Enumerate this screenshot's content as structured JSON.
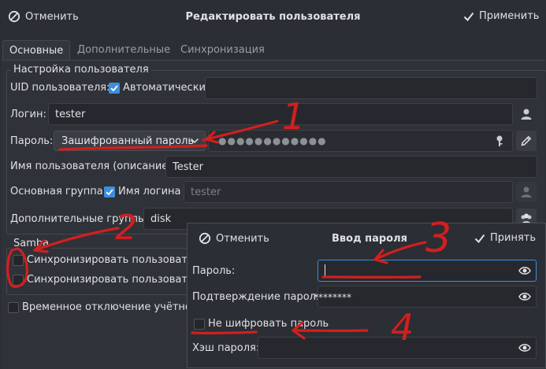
{
  "header": {
    "cancel_label": "Отменить",
    "title": "Редактировать пользователя",
    "apply_label": "Применить"
  },
  "tabs": [
    {
      "label": "Основные",
      "active": true
    },
    {
      "label": "Дополнительные",
      "active": false
    },
    {
      "label": "Синхронизация",
      "active": false
    }
  ],
  "user_settings": {
    "group_title": "Настройка пользователя",
    "uid_label": "UID пользователя:",
    "uid_auto_label": "Автоматически",
    "uid_auto_checked": true,
    "uid_value": "",
    "login_label": "Логин:",
    "login_value": "tester",
    "password_label": "Пароль:",
    "password_type": "Зашифрованный пароль",
    "password_mask": "●●●●●●●●●●●●",
    "fullname_label": "Имя пользователя (описание):",
    "fullname_value": "Tester",
    "primary_group_label": "Основная группа:",
    "primary_group_login_label": "Имя логина",
    "primary_group_login_checked": true,
    "primary_group_value": "tester",
    "extra_groups_label": "Дополнительные группы:",
    "extra_groups_value": "disk"
  },
  "samba": {
    "group_title": "Samba",
    "sync1_label": "Синхронизировать пользовател",
    "sync2_label": "Синхронизировать пользовател",
    "sync1_checked": false,
    "sync2_checked": false
  },
  "temp_disable_label": "Временное отключение учётной",
  "temp_disable_checked": false,
  "password_dialog": {
    "cancel_label": "Отменить",
    "title": "Ввод пароля",
    "accept_label": "Принять",
    "password_label": "Пароль:",
    "password_value": "",
    "confirm_label": "Подтверждение пароля:",
    "confirm_value": "********",
    "no_encrypt_label": "Не шифровать пароль",
    "no_encrypt_checked": false,
    "hash_label": "Хэш пароля:",
    "hash_value": ""
  },
  "annotations": [
    "1",
    "2",
    "3",
    "4"
  ],
  "colors": {
    "background": "#2b2e34",
    "accent": "#3d8ee0",
    "annotation": "#d21f1f"
  }
}
